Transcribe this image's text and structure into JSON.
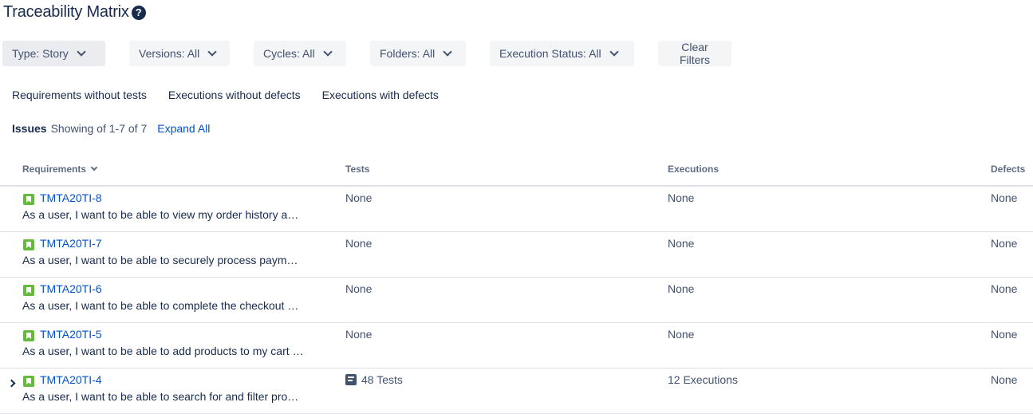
{
  "page": {
    "title": "Traceability Matrix",
    "help_glyph": "?"
  },
  "filters": [
    {
      "label": "Type: Story"
    },
    {
      "label": "Versions: All"
    },
    {
      "label": "Cycles: All"
    },
    {
      "label": "Folders: All"
    },
    {
      "label": "Execution Status: All"
    }
  ],
  "clear_filters_label": "Clear Filters",
  "quick_filters": [
    "Requirements without tests",
    "Executions without defects",
    "Executions with defects"
  ],
  "issues": {
    "label": "Issues",
    "count_text": "Showing of 1-7 of 7",
    "expand_all": "Expand All"
  },
  "table": {
    "headers": {
      "requirements": "Requirements",
      "tests": "Tests",
      "executions": "Executions",
      "defects": "Defects"
    },
    "rows": [
      {
        "key": "TMTA20TI-8",
        "summary": "As a user, I want to be able to view my order history and track my orders",
        "tests": "None",
        "executions": "None",
        "defects": "None"
      },
      {
        "key": "TMTA20TI-7",
        "summary": "As a user, I want to be able to securely process payments",
        "tests": "None",
        "executions": "None",
        "defects": "None"
      },
      {
        "key": "TMTA20TI-6",
        "summary": "As a user, I want to be able to complete the checkout process",
        "tests": "None",
        "executions": "None",
        "defects": "None"
      },
      {
        "key": "TMTA20TI-5",
        "summary": "As a user, I want to be able to add products to my cart and manage it",
        "tests": "None",
        "executions": "None",
        "defects": "None"
      },
      {
        "key": "TMTA20TI-4",
        "summary": "As a user, I want to be able to search for and filter products",
        "tests": "48 Tests",
        "executions": "12 Executions",
        "defects": "None"
      }
    ]
  },
  "colors": {
    "link": "#0052cc",
    "story_icon": "#63ba3c",
    "text": "#172b4d",
    "button_bg": "#f4f5f7"
  },
  "icons": {
    "help": "question-circle-icon",
    "story": "story-icon",
    "test": "test-icon",
    "dropdown": "chevron-down-icon",
    "expander": "chevron-right-icon"
  }
}
